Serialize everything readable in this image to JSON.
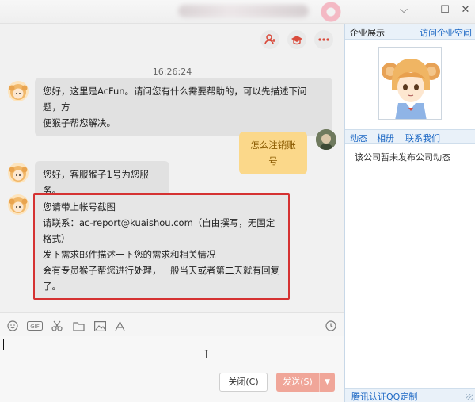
{
  "window": {
    "title_icon": "donut-icon",
    "controls": [
      {
        "name": "chevron-down-icon",
        "glyph": "⌵"
      },
      {
        "name": "minimize-icon",
        "glyph": "—"
      },
      {
        "name": "maximize-icon",
        "glyph": "☐"
      },
      {
        "name": "close-icon",
        "glyph": "✕"
      }
    ]
  },
  "chat": {
    "actions": [
      "add-user-icon",
      "hat-icon",
      "more-icon"
    ],
    "timestamp": "16:26:24",
    "messages": [
      {
        "from": "agent",
        "lines": [
          "您好，这里是AcFun。请问您有什么需要帮助的，可以先描述下问题，方",
          "便猴子帮您解决。"
        ]
      },
      {
        "from": "user",
        "lines": [
          "怎么注销账号"
        ]
      },
      {
        "from": "agent",
        "lines": [
          "您好，客服猴子1号为您服务。"
        ]
      },
      {
        "from": "agent",
        "lines": [
          "您请带上帐号截图",
          "请联系：ac-report@kuaishou.com（自由撰写，无固定格式）",
          "发下需求邮件描述一下您的需求和相关情况",
          "会有专员猴子帮您进行处理，一般当天或者第二天就有回复了。"
        ]
      }
    ]
  },
  "toolbar": {
    "tools": [
      "emoji-icon",
      "gif-icon",
      "scissors-icon",
      "folder-icon",
      "image-icon",
      "font-icon"
    ],
    "history_icon": "clock-icon"
  },
  "composer": {
    "close_label": "关闭(C)",
    "send_label": "发送(S)"
  },
  "panel": {
    "title": "企业展示",
    "link": "访问企业空间",
    "tabs": [
      "动态",
      "相册",
      "联系我们"
    ],
    "empty_text": "该公司暂未发布公司动态",
    "footer_link": "腾讯认证QQ定制"
  },
  "colors": {
    "accent": "#1b67c4",
    "send_button": "#f0a699",
    "self_bubble": "#fbd88a",
    "highlight_border": "#d53232"
  }
}
